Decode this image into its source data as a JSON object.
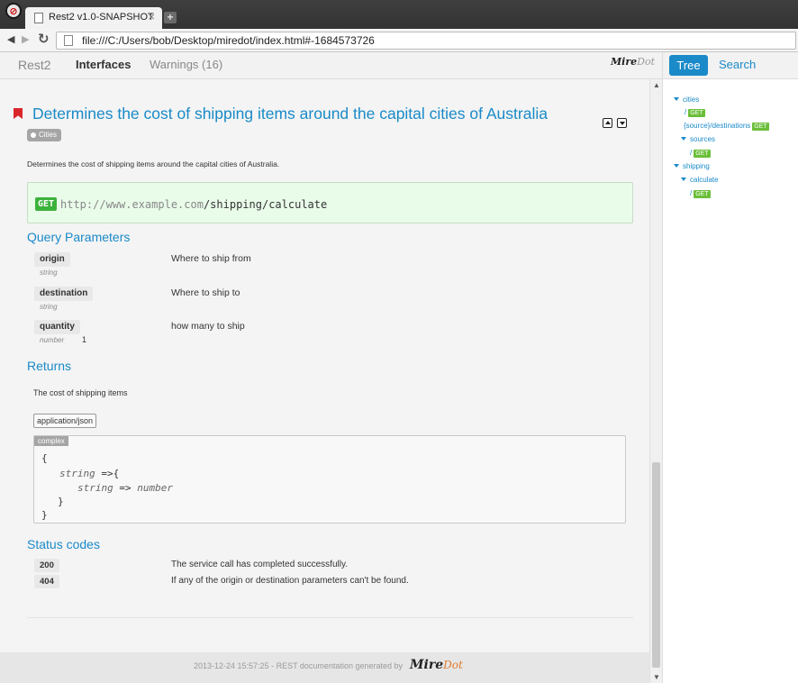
{
  "browser": {
    "tab_title": "Rest2 v1.0-SNAPSHOT",
    "tab_close": "×",
    "new_tab": "+",
    "url": "file:///C:/Users/bob/Desktop/miredot/index.html#-1684573726"
  },
  "nav": {
    "brand": "Rest2",
    "interfaces": "Interfaces",
    "warnings": "Warnings (16)",
    "logo_main": "Mire",
    "logo_accent": "Dot"
  },
  "endpoint": {
    "title": "Determines the cost of shipping items around the capital cities of Australia",
    "tag": "Cities",
    "description": "Determines the cost of shipping items around the capital cities of Australia.",
    "method": "GET",
    "base_url": "http://www.example.com",
    "path": "/shipping/calculate"
  },
  "query_params": {
    "heading": "Query Parameters",
    "items": [
      {
        "name": "origin",
        "type": "string",
        "default": "",
        "desc": "Where to ship from"
      },
      {
        "name": "destination",
        "type": "string",
        "default": "",
        "desc": "Where to ship to"
      },
      {
        "name": "quantity",
        "type": "number",
        "default": "1",
        "desc": "how many to ship"
      }
    ]
  },
  "returns": {
    "heading": "Returns",
    "description": "The cost of shipping items",
    "mime": "application/json",
    "complex_label": "complex",
    "code": {
      "l1": "{",
      "l2_type": "string",
      "l2_op": " =>{",
      "l3_type": "string",
      "l3_op": " => ",
      "l3_val": "number",
      "l4": "}",
      "l5": "}"
    }
  },
  "status_codes": {
    "heading": "Status codes",
    "items": [
      {
        "code": "200",
        "desc": "The service call has completed successfully."
      },
      {
        "code": "404",
        "desc": "If any of the origin or destination parameters can't be found."
      }
    ]
  },
  "footer": {
    "text": "2013-12-24 15:57:25 - REST documentation generated by",
    "logo_main": "Mire",
    "logo_accent": "Dot"
  },
  "sidebar": {
    "tab_tree": "Tree",
    "tab_search": "Search",
    "tree": {
      "cities": "cities",
      "cities_get_prefix": "/",
      "source_destinations": "{source}/destinations",
      "sources": "sources",
      "sources_get_prefix": "/",
      "shipping": "shipping",
      "calculate": "calculate",
      "calculate_get_prefix": "/",
      "get_badge": "GET"
    }
  },
  "colors": {
    "accent": "#1a8ac8",
    "get_green": "#3bb23b",
    "bookmark_red": "#d9262b"
  }
}
